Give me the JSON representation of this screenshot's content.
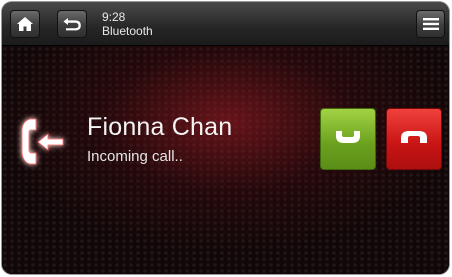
{
  "topbar": {
    "home_icon": "home-icon",
    "back_icon": "back-arrow-icon",
    "time": "9:28",
    "source": "Bluetooth",
    "menu_icon": "menu-icon"
  },
  "call": {
    "icon": "incoming-call-icon",
    "caller_name": "Fionna Chan",
    "status": "Incoming call..",
    "accept_icon": "answer-call-icon",
    "decline_icon": "end-call-icon"
  },
  "colors": {
    "accept": "#7ab42a",
    "decline": "#d81c1c",
    "glow": "#b81e2c"
  }
}
